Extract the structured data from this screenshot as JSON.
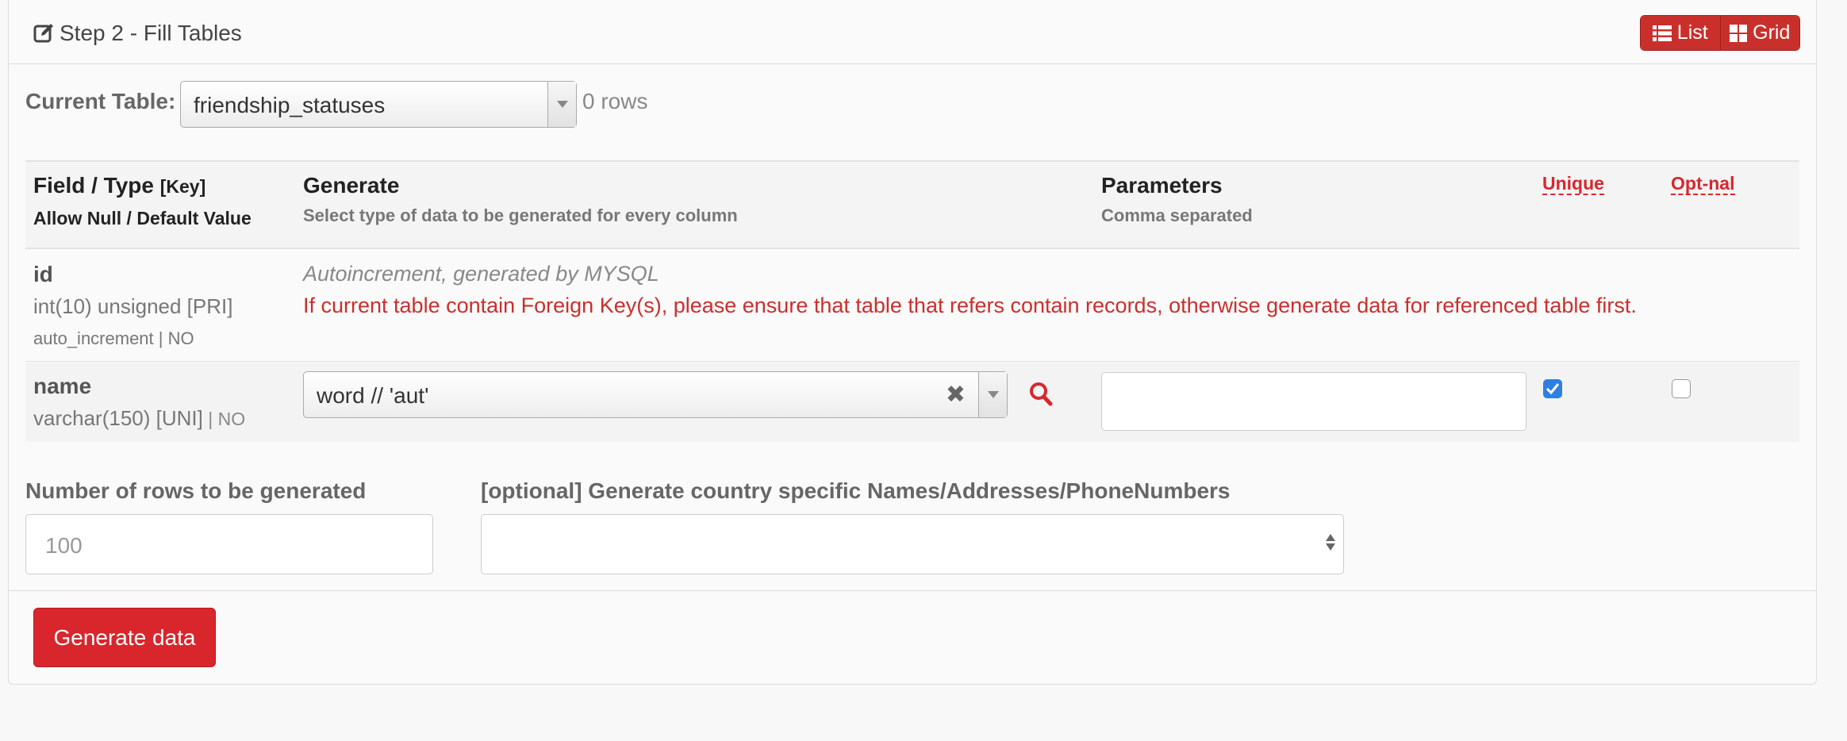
{
  "panel": {
    "title": "Step 2 - Fill Tables",
    "view_toggle": {
      "list_label": "List",
      "grid_label": "Grid"
    }
  },
  "current_table": {
    "label": "Current Table:",
    "selected": "friendship_statuses",
    "row_count": "0 rows"
  },
  "table_header": {
    "field_type": "Field / Type",
    "key": "[Key]",
    "allow_null": "Allow Null / Default Value",
    "generate": "Generate",
    "generate_sub": "Select type of data to be generated for every column",
    "parameters": "Parameters",
    "parameters_sub": "Comma separated",
    "unique": "Unique",
    "optional": "Opt-nal"
  },
  "rows": [
    {
      "field": "id",
      "type": "int(10) unsigned [PRI]",
      "null_default": "auto_increment | NO",
      "note": "Autoincrement, generated by MYSQL",
      "warning": "If current table contain Foreign Key(s), please ensure that table that refers contain records, otherwise generate data for referenced table first."
    },
    {
      "field": "name",
      "type": "varchar(150) [UNI]",
      "sep": " | ",
      "null_default": "NO",
      "generator": "word // 'aut'",
      "clear_symbol": "✖",
      "parameters": "",
      "unique": true,
      "optional": false
    }
  ],
  "bottom": {
    "rows_label": "Number of rows to be generated",
    "rows_placeholder": "100",
    "country_label": "[optional] Generate country specific Names/Addresses/PhoneNumbers",
    "country_value": ""
  },
  "actions": {
    "generate_label": "Generate data"
  },
  "colors": {
    "accent": "#d9262d",
    "checkbox": "#2f7fe0"
  },
  "icons": [
    "edit-icon",
    "list-icon",
    "grid-icon",
    "search-icon",
    "clear-icon",
    "chevron-down-icon"
  ]
}
